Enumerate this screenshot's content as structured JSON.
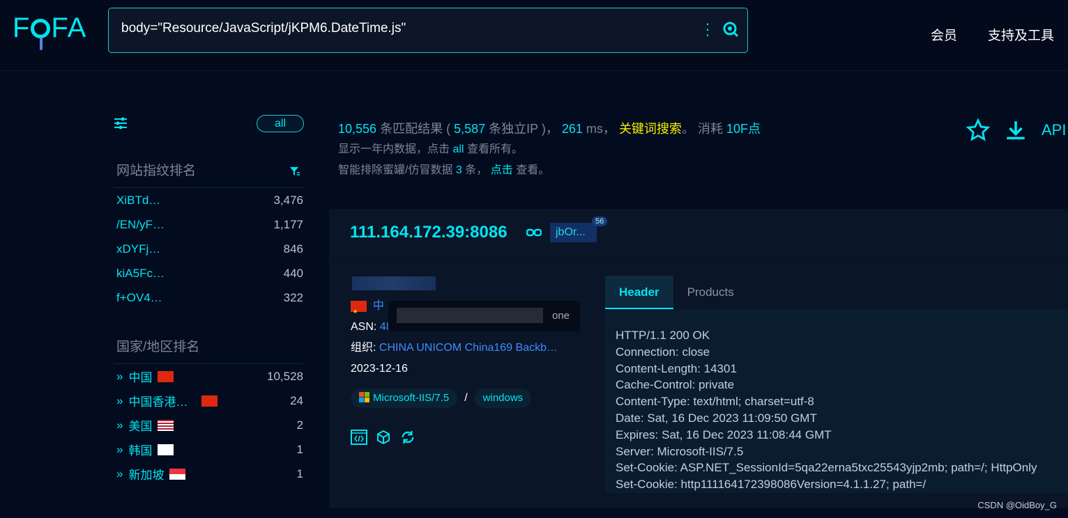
{
  "header": {
    "logo": "FOFA",
    "query": "body=\"Resource/JavaScript/jKPM6.DateTime.js\"",
    "nav": [
      "会员",
      "支持及工具"
    ]
  },
  "sidebar": {
    "all_label": "all",
    "fingerprint_title": "网站指纹排名",
    "fingerprints": [
      {
        "k": "XiBTd…",
        "v": "3,476"
      },
      {
        "k": "/EN/yF…",
        "v": "1,177"
      },
      {
        "k": "xDYFj…",
        "v": "846"
      },
      {
        "k": "kiA5Fc…",
        "v": "440"
      },
      {
        "k": "f+OV4…",
        "v": "322"
      }
    ],
    "country_title": "国家/地区排名",
    "countries": [
      {
        "k": "中国",
        "v": "10,528",
        "flag": "cn"
      },
      {
        "k": "中国香港…",
        "v": "24",
        "flag": "hk"
      },
      {
        "k": "美国",
        "v": "2",
        "flag": "us"
      },
      {
        "k": "韩国",
        "v": "1",
        "flag": "kr"
      },
      {
        "k": "新加坡",
        "v": "1",
        "flag": "sg"
      }
    ]
  },
  "summary": {
    "count": "10,556",
    "count_label": "条匹配结果 (",
    "ip_count": "5,587",
    "ip_label": "条独立IP )，",
    "ms": "261",
    "ms_label": "ms，",
    "keyword": "关键词搜索",
    "period": "。 消耗",
    "cost": "10F点",
    "l2a": "显示一年内数据，点击",
    "l2b": "all",
    "l2c": "查看所有。",
    "l3a": "智能排除蜜罐/仿冒数据",
    "l3b": "3",
    "l3c": "条，",
    "l3d": "点击",
    "l3e": "查看。"
  },
  "actions": {
    "api": "API"
  },
  "result": {
    "ip": "111.164.172.39:8086",
    "tag": "jbOr...",
    "tag_count": "56",
    "country": "中",
    "tooltip_tail": "one",
    "asn_label": "ASN:",
    "asn": "4837",
    "org_label": "组织:",
    "org": "CHINA UNICOM China169 Backb…",
    "date": "2023-12-16",
    "server": "Microsoft-IIS/7.5",
    "sep": "/",
    "os": "windows",
    "tabs": [
      "Header",
      "Products"
    ],
    "headers": [
      "HTTP/1.1 200 OK",
      "Connection: close",
      "Content-Length: 14301",
      "Cache-Control: private",
      "Content-Type: text/html; charset=utf-8",
      "Date: Sat, 16 Dec 2023 11:09:50 GMT",
      "Expires: Sat, 16 Dec 2023 11:08:44 GMT",
      "Server: Microsoft-IIS/7.5",
      "Set-Cookie: ASP.NET_SessionId=5qa22erna5txc25543yjp2mb; path=/; HttpOnly",
      "Set-Cookie: http111164172398086Version=4.1.1.27; path=/"
    ]
  },
  "watermark": "CSDN @OidBoy_G",
  "colors": {
    "accent": "#00e5ef",
    "keyword": "#f7f000",
    "link": "#3d8bff",
    "background": "#030b1f"
  }
}
